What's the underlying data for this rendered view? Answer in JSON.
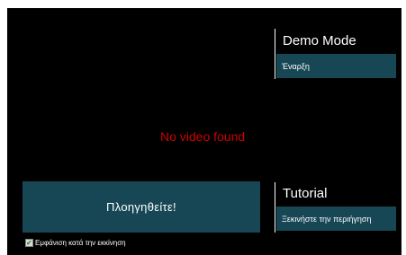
{
  "video": {
    "message": "No video found",
    "message_color": "#cc0000"
  },
  "navigate_button": {
    "label": "Πλοηγηθείτε!"
  },
  "demo_mode": {
    "title": "Demo Mode",
    "button_label": "Έναρξη"
  },
  "tutorial": {
    "title": "Tutorial",
    "button_label": "Ξεκινήστε την περιήγηση"
  },
  "startup_option": {
    "label": "Εμφάνιση κατά την εκκίνηση",
    "checked": true
  },
  "colors": {
    "background": "#000000",
    "button": "#174755",
    "text": "#ffffff"
  }
}
